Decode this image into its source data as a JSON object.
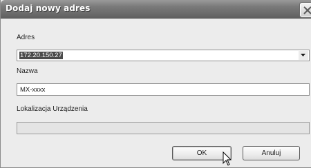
{
  "dialog": {
    "title": "Dodaj nowy adres",
    "address_label": "Adres",
    "address_value": "172.20.150.27",
    "name_label": "Nazwa",
    "name_value": "MX-xxxx",
    "location_label": "Lokalizacja Urządzenia",
    "location_value": "",
    "ok_label": "OK",
    "cancel_label": "Anuluj"
  },
  "icons": {
    "close": "close-icon",
    "dropdown": "chevron-down-icon",
    "cursor": "mouse-pointer-icon"
  }
}
